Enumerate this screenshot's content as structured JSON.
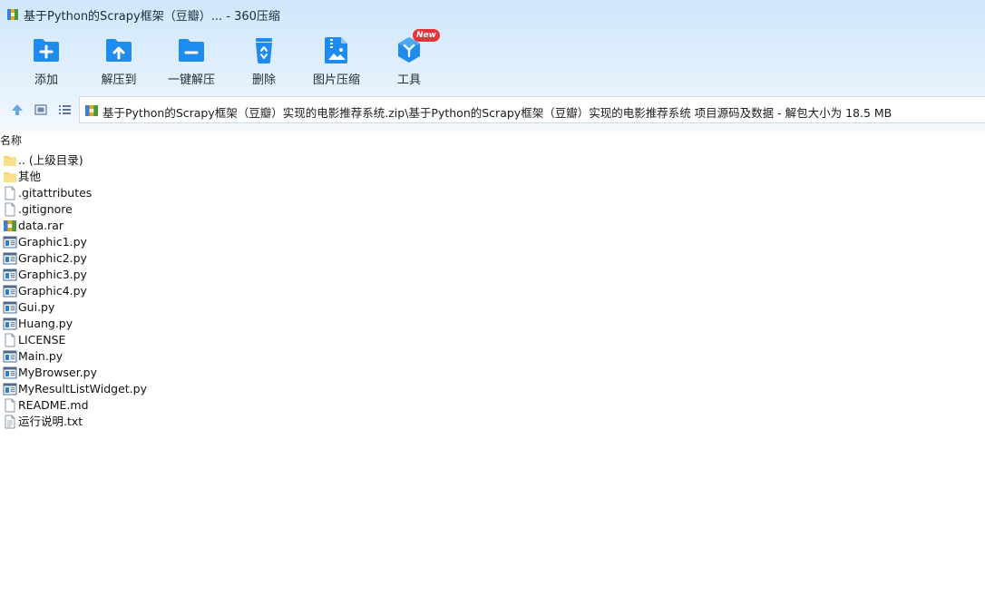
{
  "window": {
    "title": "基于Python的Scrapy框架（豆瓣）... - 360压缩"
  },
  "toolbar": {
    "items": [
      {
        "label": "添加",
        "icon": "add-folder-icon"
      },
      {
        "label": "解压到",
        "icon": "extract-to-icon"
      },
      {
        "label": "一键解压",
        "icon": "one-click-extract-icon"
      },
      {
        "label": "删除",
        "icon": "recycle-bin-icon"
      },
      {
        "label": "图片压缩",
        "icon": "image-compress-icon"
      },
      {
        "label": "工具",
        "icon": "tools-cube-icon",
        "badge": "New"
      }
    ]
  },
  "address": {
    "path": "基于Python的Scrapy框架（豆瓣）实现的电影推荐系统.zip\\基于Python的Scrapy框架（豆瓣）实现的电影推荐系统 项目源码及数据 - 解包大小为 18.5 MB"
  },
  "list": {
    "column_name": "名称",
    "rows": [
      {
        "name": ".. (上级目录)",
        "icon": "folder-icon"
      },
      {
        "name": "其他",
        "icon": "folder-icon"
      },
      {
        "name": ".gitattributes",
        "icon": "file-icon"
      },
      {
        "name": ".gitignore",
        "icon": "file-icon"
      },
      {
        "name": "data.rar",
        "icon": "archive-icon"
      },
      {
        "name": "Graphic1.py",
        "icon": "python-file-icon"
      },
      {
        "name": "Graphic2.py",
        "icon": "python-file-icon"
      },
      {
        "name": "Graphic3.py",
        "icon": "python-file-icon"
      },
      {
        "name": "Graphic4.py",
        "icon": "python-file-icon"
      },
      {
        "name": "Gui.py",
        "icon": "python-file-icon"
      },
      {
        "name": "Huang.py",
        "icon": "python-file-icon"
      },
      {
        "name": "LICENSE",
        "icon": "file-icon"
      },
      {
        "name": "Main.py",
        "icon": "python-file-icon"
      },
      {
        "name": "MyBrowser.py",
        "icon": "python-file-icon"
      },
      {
        "name": "MyResultListWidget.py",
        "icon": "python-file-icon"
      },
      {
        "name": "README.md",
        "icon": "file-icon"
      },
      {
        "name": "运行说明.txt",
        "icon": "text-file-icon"
      }
    ]
  }
}
